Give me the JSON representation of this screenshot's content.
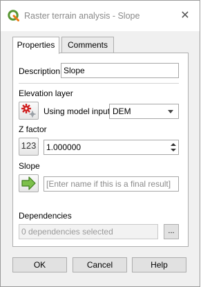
{
  "window": {
    "title": "Raster terrain analysis - Slope",
    "close_glyph": "✕",
    "app_icon": "qgis-logo-icon",
    "brand_color": "#589632"
  },
  "tabs": [
    {
      "label": "Properties",
      "active": true
    },
    {
      "label": "Comments",
      "active": false
    }
  ],
  "form": {
    "description_label": "Description",
    "description_value": "Slope",
    "elevation_label": "Elevation layer",
    "elevation_icon": "model-input-icon",
    "elevation_mode_label": "Using model input",
    "elevation_value": "DEM",
    "zfactor_label": "Z factor",
    "zfactor_icon": "numeric-123-icon",
    "zfactor_icon_text": "123",
    "zfactor_value": "1.000000",
    "slope_label": "Slope",
    "slope_icon": "output-arrow-icon",
    "slope_placeholder": "[Enter name if this is a final result]",
    "dependencies_label": "Dependencies",
    "dependencies_value": "0 dependencies selected",
    "dependencies_button": "..."
  },
  "buttons": {
    "ok": "OK",
    "cancel": "Cancel",
    "help": "Help"
  }
}
